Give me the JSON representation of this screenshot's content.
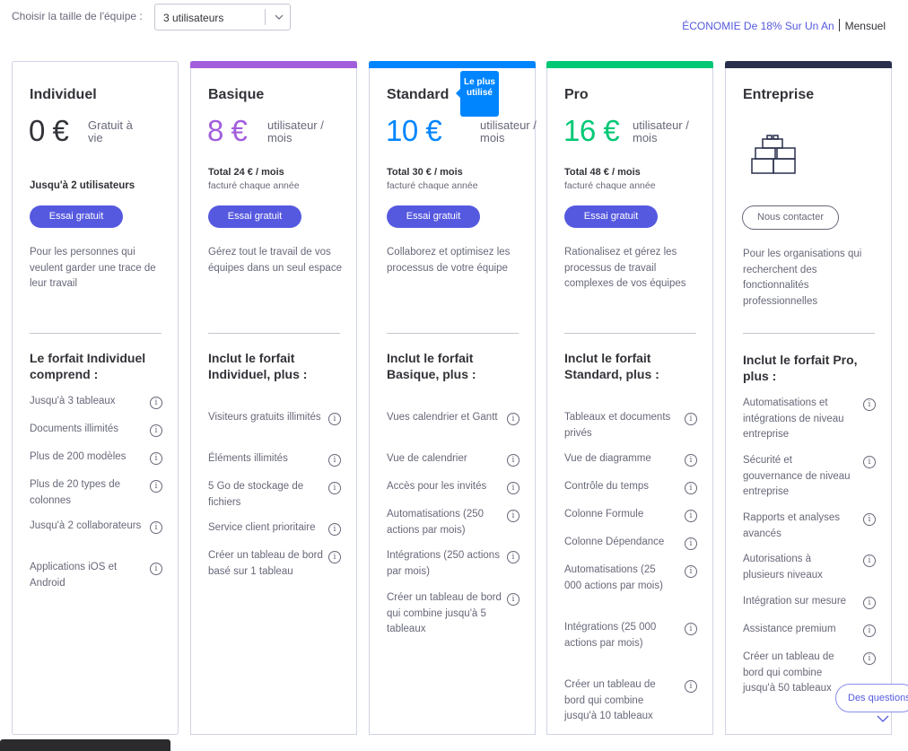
{
  "header": {
    "team_label": "Choisir la taille de l'équipe :",
    "team_value": "3 utilisateurs",
    "economy": "ÉCONOMIE De 18% Sur Un An",
    "monthly": "Mensuel"
  },
  "colors": {
    "accent": "#5559df",
    "basique": "#a25ddc",
    "standard": "#0085ff",
    "pro": "#00c875",
    "entreprise": "#292f4c"
  },
  "popular_badge": "Le plus utilisé",
  "faq_label": "Des questions",
  "plans": [
    {
      "name": "Individuel",
      "price": "0 €",
      "unit": "Gratuit à vie",
      "up_to": "Jusqu'à 2 utilisateurs",
      "cta": "Essai gratuit",
      "description": "Pour les personnes qui veulent garder une trace de leur travail",
      "includes": "Le forfait Individuel comprend :",
      "features": [
        "Jusqu'à 3 tableaux",
        "Documents illimités",
        "Plus de 200 modèles",
        "Plus de 20 types de colonnes",
        "Jusqu'à 2 collaborateurs",
        "Applications iOS et Android"
      ]
    },
    {
      "name": "Basique",
      "price": "8 €",
      "unit": "utilisateur / mois",
      "total": "Total 24 € / mois",
      "billed": "facturé chaque année",
      "cta": "Essai gratuit",
      "description": "Gérez tout le travail de vos équipes dans un seul espace",
      "includes": "Inclut le forfait Individuel, plus :",
      "features": [
        "Visiteurs gratuits illimités",
        "Éléments illimités",
        "5 Go de stockage de fichiers",
        "Service client prioritaire",
        "Créer un tableau de bord basé sur 1 tableau"
      ]
    },
    {
      "name": "Standard",
      "price": "10 €",
      "unit": "utilisateur / mois",
      "total": "Total 30 € / mois",
      "billed": "facturé chaque année",
      "cta": "Essai gratuit",
      "description": "Collaborez et optimisez les processus de votre équipe",
      "includes": "Inclut le forfait Basique, plus :",
      "features": [
        "Vues calendrier et Gantt",
        "Vue de calendrier",
        "Accès pour les invités",
        "Automatisations (250 actions par mois)",
        "Intégrations (250 actions par mois)",
        "Créer un tableau de bord qui combine jusqu'à 5 tableaux"
      ]
    },
    {
      "name": "Pro",
      "price": "16 €",
      "unit": "utilisateur / mois",
      "total": "Total 48 € / mois",
      "billed": "facturé chaque année",
      "cta": "Essai gratuit",
      "description": "Rationalisez et gérez les processus de travail complexes de vos équipes",
      "includes": "Inclut le forfait Standard, plus :",
      "features": [
        "Tableaux et documents privés",
        "Vue de diagramme",
        "Contrôle du temps",
        "Colonne Formule",
        "Colonne Dépendance",
        "Automatisations (25 000 actions par mois)",
        "Intégrations (25 000 actions par mois)",
        "Créer un tableau de bord qui combine jusqu'à 10 tableaux"
      ]
    },
    {
      "name": "Entreprise",
      "cta": "Nous contacter",
      "description": "Pour les organisations qui recherchent des fonctionnalités professionnelles",
      "includes": "Inclut le forfait Pro, plus :",
      "features": [
        "Automatisations et intégrations de niveau entreprise",
        "Sécurité et gouvernance de niveau entreprise",
        "Rapports et analyses avancés",
        "Autorisations à plusieurs niveaux",
        "Intégration sur mesure",
        "Assistance premium",
        "Créer un tableau de bord qui combine jusqu'à 50 tableaux"
      ]
    }
  ]
}
